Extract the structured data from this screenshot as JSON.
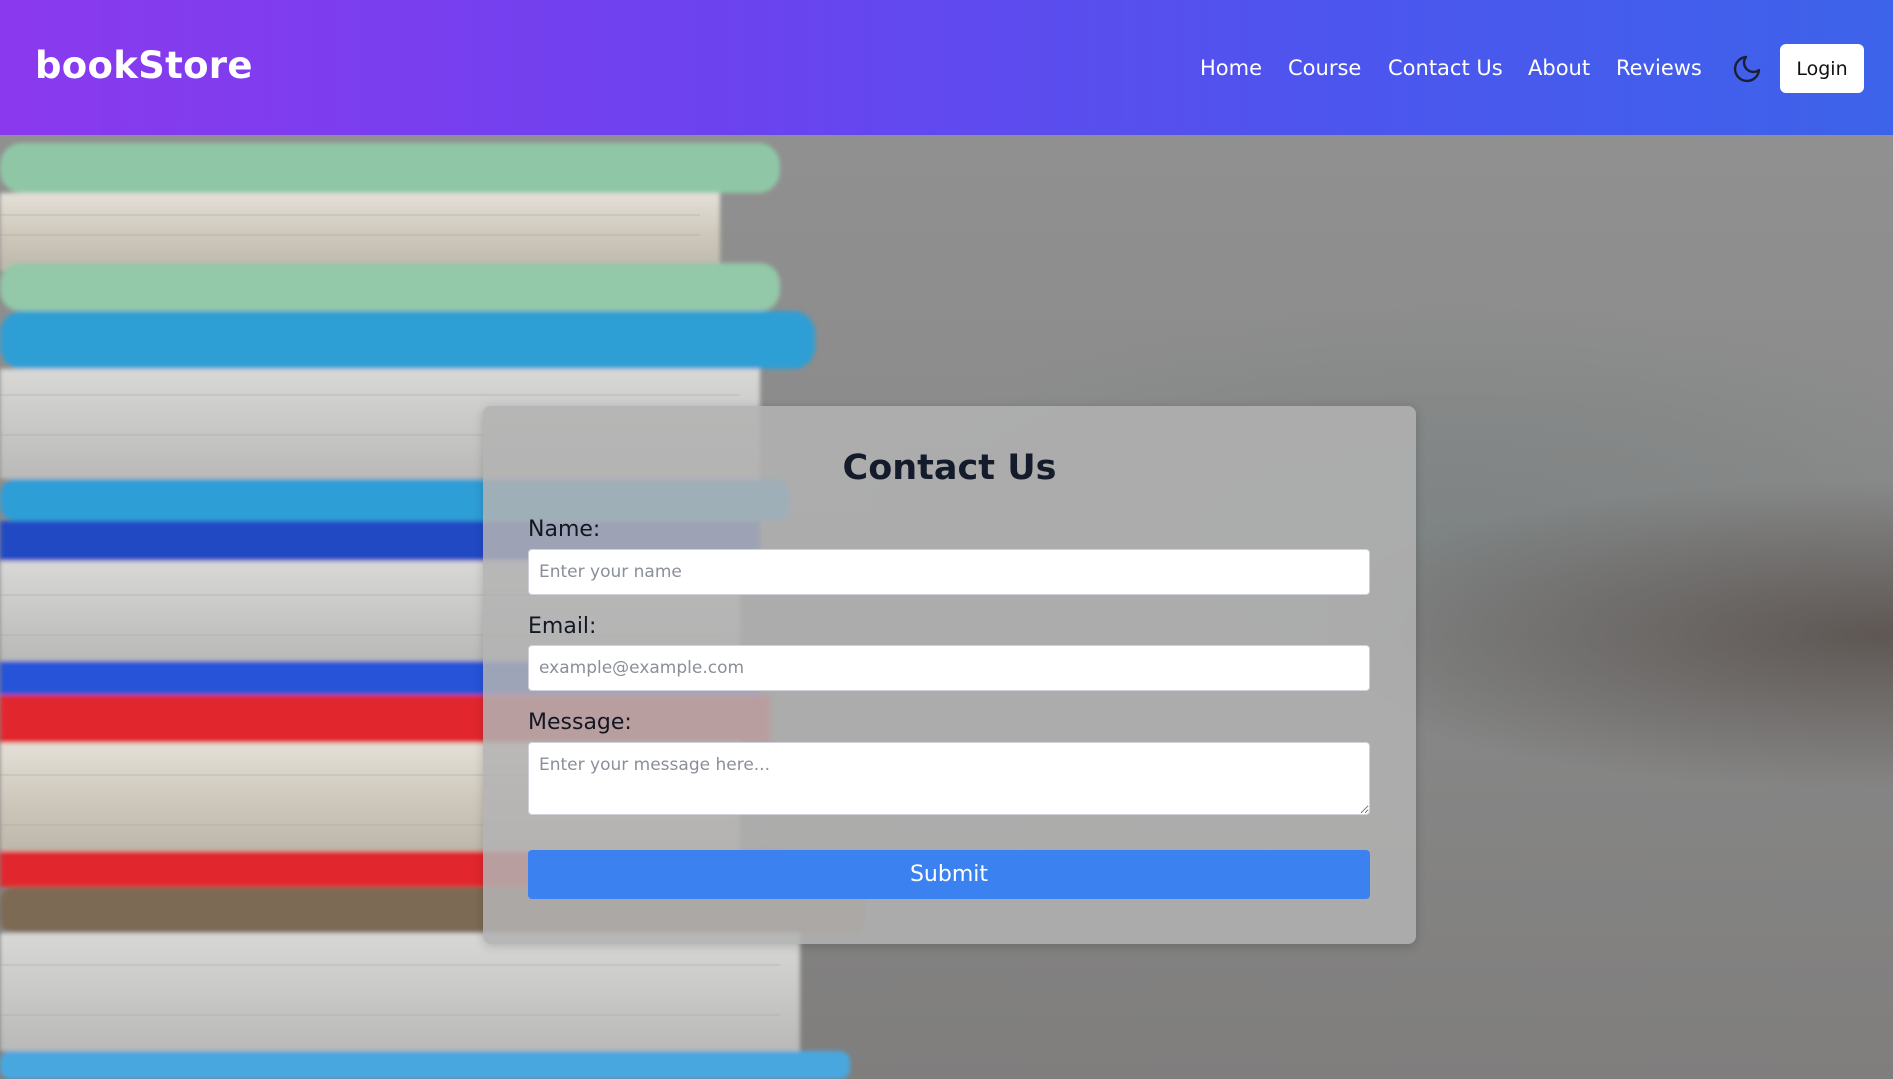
{
  "navbar": {
    "brand": "bookStore",
    "links": [
      "Home",
      "Course",
      "Contact Us",
      "About",
      "Reviews"
    ],
    "theme_toggle_icon": "moon-icon",
    "login_label": "Login"
  },
  "contact": {
    "title": "Contact Us",
    "name_label": "Name:",
    "name_placeholder": "Enter your name",
    "name_value": "",
    "email_label": "Email:",
    "email_placeholder": "example@example.com",
    "email_value": "",
    "message_label": "Message:",
    "message_placeholder": "Enter your message here...",
    "message_value": "",
    "submit_label": "Submit"
  },
  "colors": {
    "nav_gradient_start": "#8b39ee",
    "nav_gradient_end": "#3d63ea",
    "submit_button": "#3b82f0",
    "title_text": "#141b2b"
  }
}
